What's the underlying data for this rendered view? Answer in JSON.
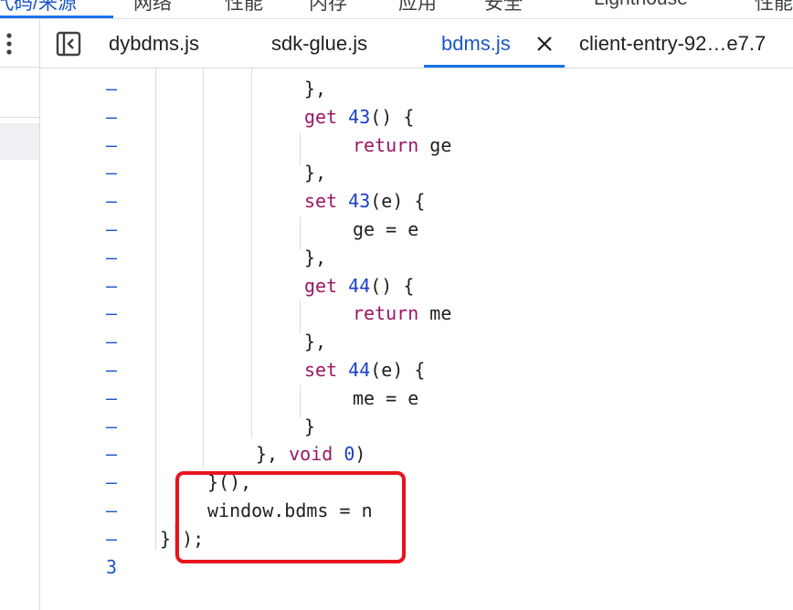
{
  "top_tabs": [
    {
      "label": "代码/来源",
      "active": true
    },
    {
      "label": "网络",
      "active": false
    },
    {
      "label": "性能",
      "active": false
    },
    {
      "label": "内存",
      "active": false
    },
    {
      "label": "应用",
      "active": false
    },
    {
      "label": "安全",
      "active": false
    },
    {
      "label": "Lighthouse",
      "active": false
    },
    {
      "label": "性能",
      "active": false
    }
  ],
  "file_tabs": [
    {
      "label": "dybdms.js",
      "active": false
    },
    {
      "label": "sdk-glue.js",
      "active": false
    },
    {
      "label": "bdms.js",
      "active": true
    },
    {
      "label": "client-entry-92…e7.7",
      "active": false
    }
  ],
  "icons": {
    "menu": "kebab-menu-icon",
    "sidebar_toggle": "sidebar-toggle-icon",
    "close": "close-icon"
  },
  "colors": {
    "accent": "#1a73e8",
    "keyword": "#9b1664",
    "number": "#1a3ec8",
    "highlight_box": "#e8141c"
  },
  "code_lines": [
    {
      "gutter": "–",
      "tokens": [
        {
          "t": "},",
          "c": "p"
        }
      ]
    },
    {
      "gutter": "–",
      "tokens": [
        {
          "t": "get",
          "c": "kw"
        },
        {
          "t": " ",
          "c": "p"
        },
        {
          "t": "43",
          "c": "num"
        },
        {
          "t": "() {",
          "c": "p"
        }
      ]
    },
    {
      "gutter": "–",
      "tokens": [
        {
          "t": "return",
          "c": "kw"
        },
        {
          "t": " ge",
          "c": "p"
        }
      ]
    },
    {
      "gutter": "–",
      "tokens": [
        {
          "t": "},",
          "c": "p"
        }
      ]
    },
    {
      "gutter": "–",
      "tokens": [
        {
          "t": "set",
          "c": "kw"
        },
        {
          "t": " ",
          "c": "p"
        },
        {
          "t": "43",
          "c": "num"
        },
        {
          "t": "(e) {",
          "c": "p"
        }
      ]
    },
    {
      "gutter": "–",
      "tokens": [
        {
          "t": "ge = e",
          "c": "p"
        }
      ]
    },
    {
      "gutter": "–",
      "tokens": [
        {
          "t": "},",
          "c": "p"
        }
      ]
    },
    {
      "gutter": "–",
      "tokens": [
        {
          "t": "get",
          "c": "kw"
        },
        {
          "t": " ",
          "c": "p"
        },
        {
          "t": "44",
          "c": "num"
        },
        {
          "t": "() {",
          "c": "p"
        }
      ]
    },
    {
      "gutter": "–",
      "tokens": [
        {
          "t": "return",
          "c": "kw"
        },
        {
          "t": " me",
          "c": "p"
        }
      ]
    },
    {
      "gutter": "–",
      "tokens": [
        {
          "t": "},",
          "c": "p"
        }
      ]
    },
    {
      "gutter": "–",
      "tokens": [
        {
          "t": "set",
          "c": "kw"
        },
        {
          "t": " ",
          "c": "p"
        },
        {
          "t": "44",
          "c": "num"
        },
        {
          "t": "(e) {",
          "c": "p"
        }
      ]
    },
    {
      "gutter": "–",
      "tokens": [
        {
          "t": "me = e",
          "c": "p"
        }
      ]
    },
    {
      "gutter": "–",
      "tokens": [
        {
          "t": "}",
          "c": "p"
        }
      ]
    },
    {
      "gutter": "–",
      "tokens": [
        {
          "t": "}, ",
          "c": "p"
        },
        {
          "t": "void",
          "c": "kw"
        },
        {
          "t": " ",
          "c": "p"
        },
        {
          "t": "0",
          "c": "num"
        },
        {
          "t": ")",
          "c": "p"
        }
      ]
    },
    {
      "gutter": "–",
      "tokens": [
        {
          "t": "}(),",
          "c": "p"
        }
      ]
    },
    {
      "gutter": "–",
      "tokens": [
        {
          "t": "window.bdms = n",
          "c": "p"
        }
      ]
    },
    {
      "gutter": "–",
      "tokens": [
        {
          "t": "}",
          "c": "p"
        },
        {
          "t": " );",
          "c": "p"
        }
      ]
    },
    {
      "gutter": "3",
      "tokens": []
    }
  ]
}
